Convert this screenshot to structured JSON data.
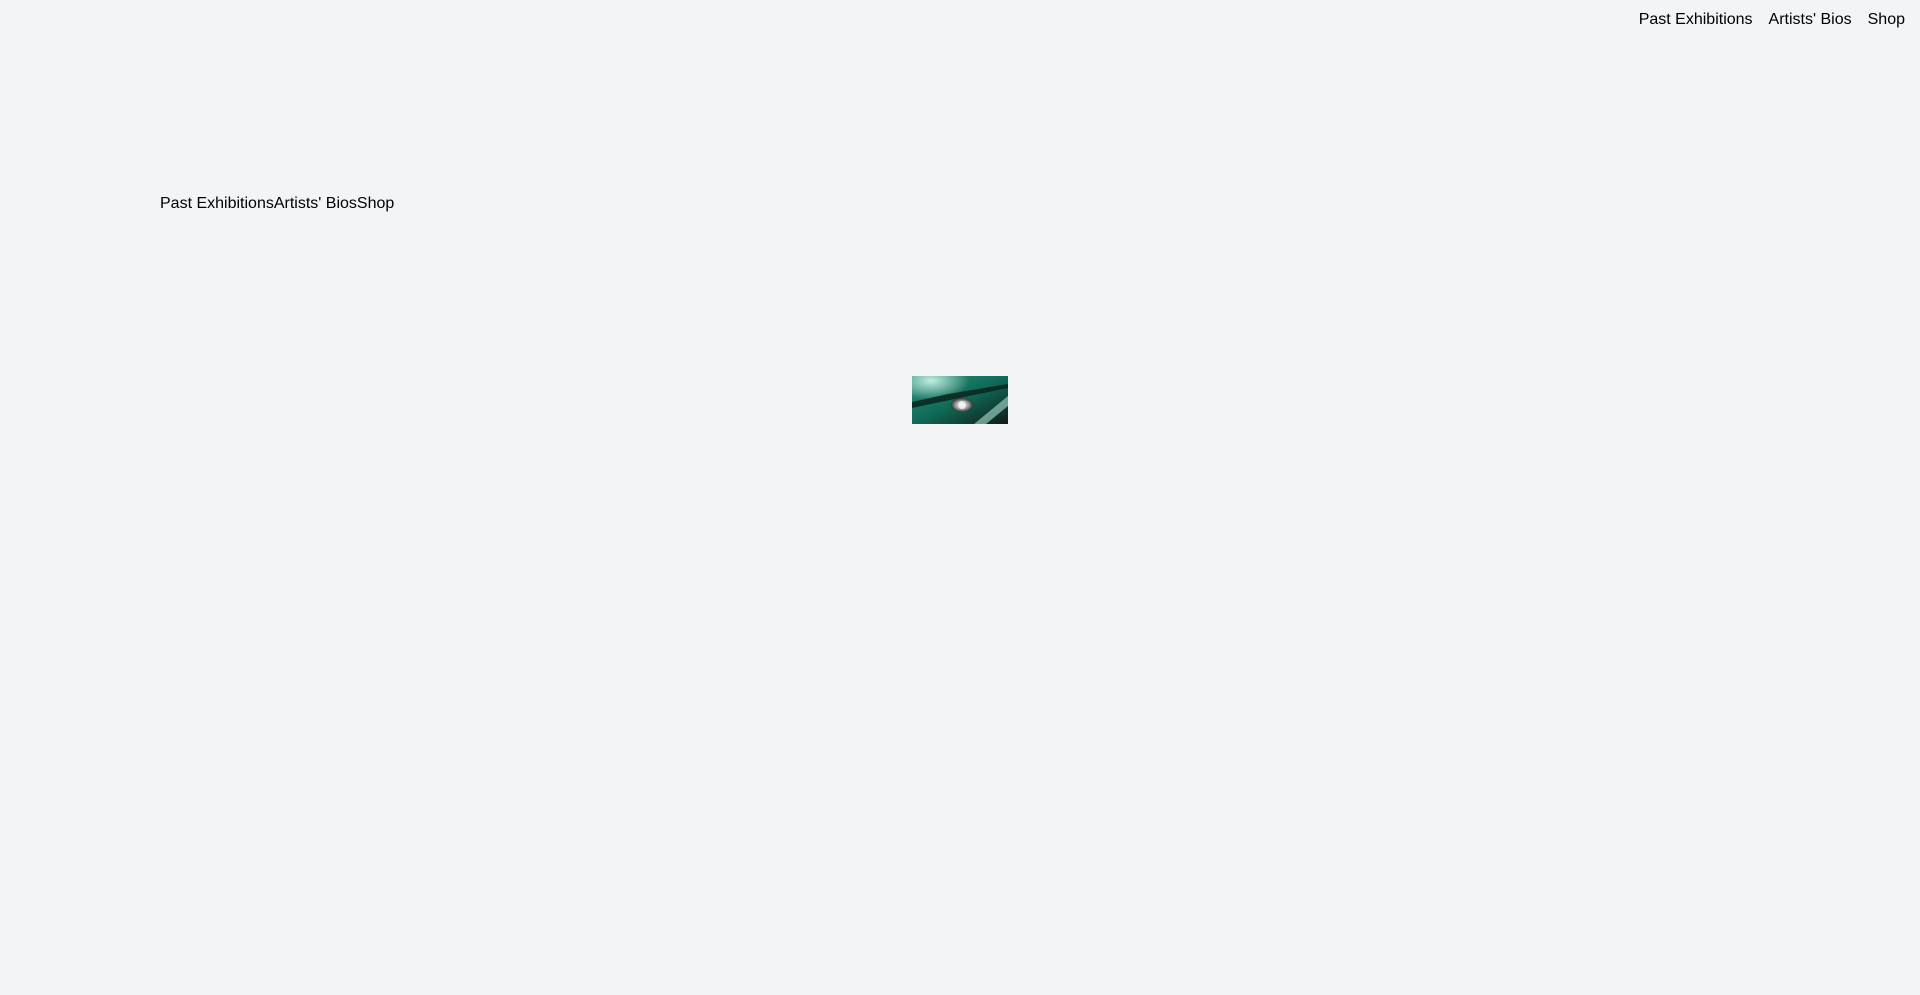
{
  "top_nav": {
    "items": [
      {
        "label": "Past Exhibitions"
      },
      {
        "label": "Artists' Bios"
      },
      {
        "label": "Shop"
      }
    ]
  },
  "inline_nav": {
    "items": [
      {
        "label": "Past Exhibitions"
      },
      {
        "label": "Artists' Bios"
      },
      {
        "label": "Shop"
      }
    ]
  },
  "image": {
    "icon": "car-emblem-photo"
  },
  "colors": {
    "background": "#f3f4f6",
    "text": "#000000",
    "image_primary": "#0f6b57",
    "image_dark": "#111a17",
    "image_highlight": "#c9f1e6"
  }
}
